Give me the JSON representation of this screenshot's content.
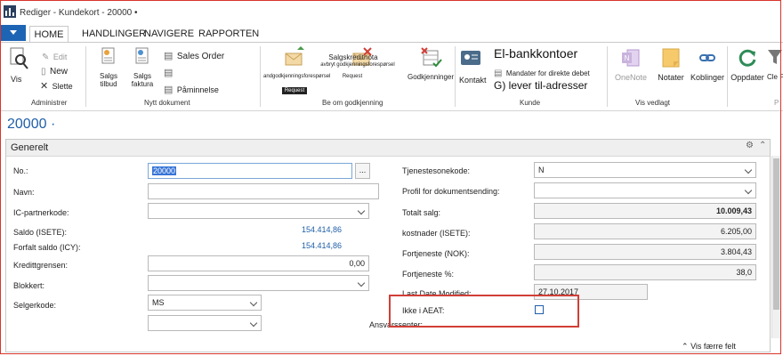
{
  "window": {
    "title": "Rediger - Kundekort - 20000 •"
  },
  "ribbon": {
    "tabs": [
      "HOME",
      "HANDLINGER",
      "NAVIGERE",
      "RAPPORTEN"
    ],
    "groups": {
      "administrer": {
        "label": "Administrer",
        "view": "Vis",
        "edit": "Edit",
        "new": "New",
        "delete": "Slette"
      },
      "nytt_dokument": {
        "label": "Nytt dokument",
        "sales_quote": "Salgs tilbud",
        "sales_invoice": "Salgs faktura",
        "sales_order": "Sales Order",
        "reminder": "Påminnelse"
      },
      "be_om_godkjenning": {
        "label": "Be om godkjenning",
        "send_approval": "andgodkjenningsforespørsel",
        "send_approval_sub": "Request",
        "cancel_approval": "Salgskreditnota",
        "cancel_approval_2": "avbryt godkjenningsforespørsel",
        "cancel_approval_sub": "Request",
        "approvals": "Godkjenninger"
      },
      "kunde": {
        "label": "Kunde",
        "contact": "Kontakt",
        "bank_accounts": "El-bankkontoer",
        "mandates": "Mandater for direkte debet",
        "ship_to": "G) lever til-adresser"
      },
      "vis_vedlagt": {
        "label": "Vis vedlagt",
        "onenote": "OneNote",
        "notes": "Notater",
        "links": "Koblinger"
      },
      "extra": {
        "refresh": "Oppdater",
        "clear_filter": "Cle Filt",
        "label_partial": "P"
      }
    }
  },
  "record": {
    "title": "20000 ·"
  },
  "fasttab": {
    "title": "Generelt",
    "show_less": "Vis færre felt"
  },
  "left_fields": {
    "no": {
      "label": "No.:",
      "value": "20000",
      "assist": "..."
    },
    "name": {
      "label": "Navn:",
      "value": ""
    },
    "ic_partner": {
      "label": "IC-partnerkode:",
      "value": ""
    },
    "balance": {
      "label": "Saldo (ISETE):",
      "value": "154.414,86"
    },
    "balance_due": {
      "label": "Forfalt saldo (ICY):",
      "value": "154.414,86"
    },
    "credit_limit": {
      "label": "Kredittgrensen:",
      "value": "0,00"
    },
    "blocked": {
      "label": "Blokkert:",
      "value": ""
    },
    "salesperson": {
      "label": "Selgerkode:",
      "value": "MS"
    },
    "responsibility": {
      "label": "Ansvarssenter:",
      "value": ""
    }
  },
  "right_fields": {
    "service_zone": {
      "label": "Tjenestesonekode:",
      "value": "N"
    },
    "doc_profile": {
      "label": "Profil for dokumentsending:",
      "value": ""
    },
    "total_sales": {
      "label": "Totalt salg:",
      "value": "10.009,43"
    },
    "costs": {
      "label": "kostnader (ISETE):",
      "value": "6.205,00"
    },
    "profit": {
      "label": "Fortjeneste (NOK):",
      "value": "3.804,43"
    },
    "profit_pct": {
      "label": "Fortjeneste %:",
      "value": "38,0"
    },
    "last_modified": {
      "label": "Last Date Modified:",
      "value": "27.10.2017"
    },
    "not_in_aeat": {
      "label": "Ikke i AEAT:"
    }
  },
  "colors": {
    "accent": "#1e64b4",
    "highlight": "#d13f37",
    "link": "#1f5fa8"
  }
}
